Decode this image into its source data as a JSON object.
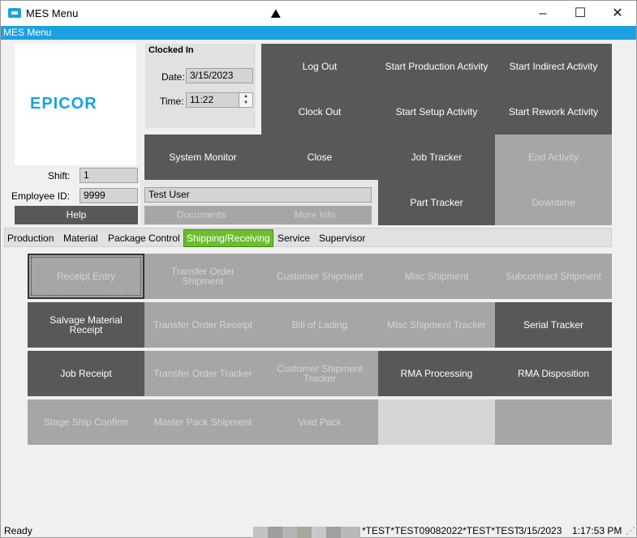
{
  "window": {
    "title": "MES Menu"
  },
  "menuband": {
    "label": "MES Menu"
  },
  "logo": {
    "text": "EPICOR"
  },
  "clock": {
    "title": "Clocked In",
    "date_label": "Date:",
    "date_value": "3/15/2023",
    "time_label": "Time:",
    "time_value": "11:22"
  },
  "employee": {
    "shift_label": "Shift:",
    "shift_value": "1",
    "id_label": "Employee ID:",
    "id_value": "9999",
    "name_value": "Test User"
  },
  "actions": {
    "log_out": "Log Out",
    "start_production": "Start Production Activity",
    "start_indirect": "Start Indirect Activity",
    "clock_out": "Clock Out",
    "start_setup": "Start Setup Activity",
    "start_rework": "Start Rework Activity",
    "system_monitor": "System Monitor",
    "close": "Close",
    "job_tracker": "Job Tracker",
    "end_activity": "End Activity",
    "part_tracker": "Part Tracker",
    "downtime": "Downtime",
    "help": "Help",
    "documents": "Documents",
    "more_info": "More Info"
  },
  "tabs": [
    {
      "label": "Production"
    },
    {
      "label": "Material"
    },
    {
      "label": "Package Control"
    },
    {
      "label": "Shipping/Receiving"
    },
    {
      "label": "Service"
    },
    {
      "label": "Supervisor"
    }
  ],
  "active_tab": "Shipping/Receiving",
  "grid": {
    "receipt_entry": "Receipt Entry",
    "transfer_order_shipment": "Transfer Order Shipment",
    "customer_shipment": "Customer Shipment",
    "misc_shipment": "Misc Shipment",
    "subcontract_shipment": "Subcontract Shipment",
    "salvage_material_receipt": "Salvage Material Receipt",
    "transfer_order_receipt": "Transfer Order Receipt",
    "bill_of_lading": "Bill of Lading",
    "misc_shipment_tracker": "Misc Shipment Tracker",
    "serial_tracker": "Serial Tracker",
    "job_receipt": "Job Receipt",
    "transfer_order_tracker": "Transfer Order Tracker",
    "customer_shipment_tracker": "Customer Shipment Tracker",
    "rma_processing": "RMA Processing",
    "rma_disposition": "RMA Disposition",
    "stage_ship_confirm": "Stage Ship Confirm",
    "master_pack_shipment": "Master Pack Shipment",
    "void_pack": "Void Pack"
  },
  "status": {
    "ready": "Ready",
    "company": "*TEST*TEST09082022*TEST*TEST",
    "date": "3/15/2023",
    "time": "1:17:53 PM"
  },
  "colors": {
    "accent": "#1ba1e2",
    "tile_dark": "#585858",
    "tile_disabled": "#a6a6a6",
    "active_tab": "#6cbd2f"
  }
}
